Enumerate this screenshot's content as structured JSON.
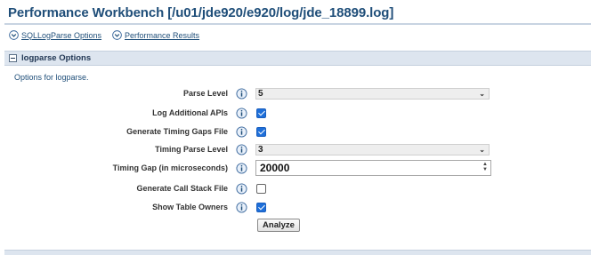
{
  "title": "Performance Workbench [/u01/jde920/e920/log/jde_18899.log]",
  "tabs": [
    {
      "label": "SQLLogParse Options",
      "icon": "chevron-down-circle-icon"
    },
    {
      "label": "Performance Results",
      "icon": "chevron-down-circle-icon"
    }
  ],
  "section": {
    "title": "logparse Options",
    "description": "Options for logparse."
  },
  "fields": {
    "parse_level": {
      "label": "Parse Level",
      "value": "5"
    },
    "log_additional_apis": {
      "label": "Log Additional APIs",
      "checked": true
    },
    "generate_timing_gaps_file": {
      "label": "Generate Timing Gaps File",
      "checked": true
    },
    "timing_parse_level": {
      "label": "Timing Parse Level",
      "value": "3"
    },
    "timing_gap": {
      "label": "Timing Gap (in microseconds)",
      "value": "20000"
    },
    "generate_call_stack_file": {
      "label": "Generate Call Stack File",
      "checked": false
    },
    "show_table_owners": {
      "label": "Show Table Owners",
      "checked": true
    }
  },
  "analyze_button": "Analyze",
  "colors": {
    "title": "#1f4e79",
    "header_bg": "#dde5ef",
    "checkbox_on": "#1e6fd9"
  }
}
